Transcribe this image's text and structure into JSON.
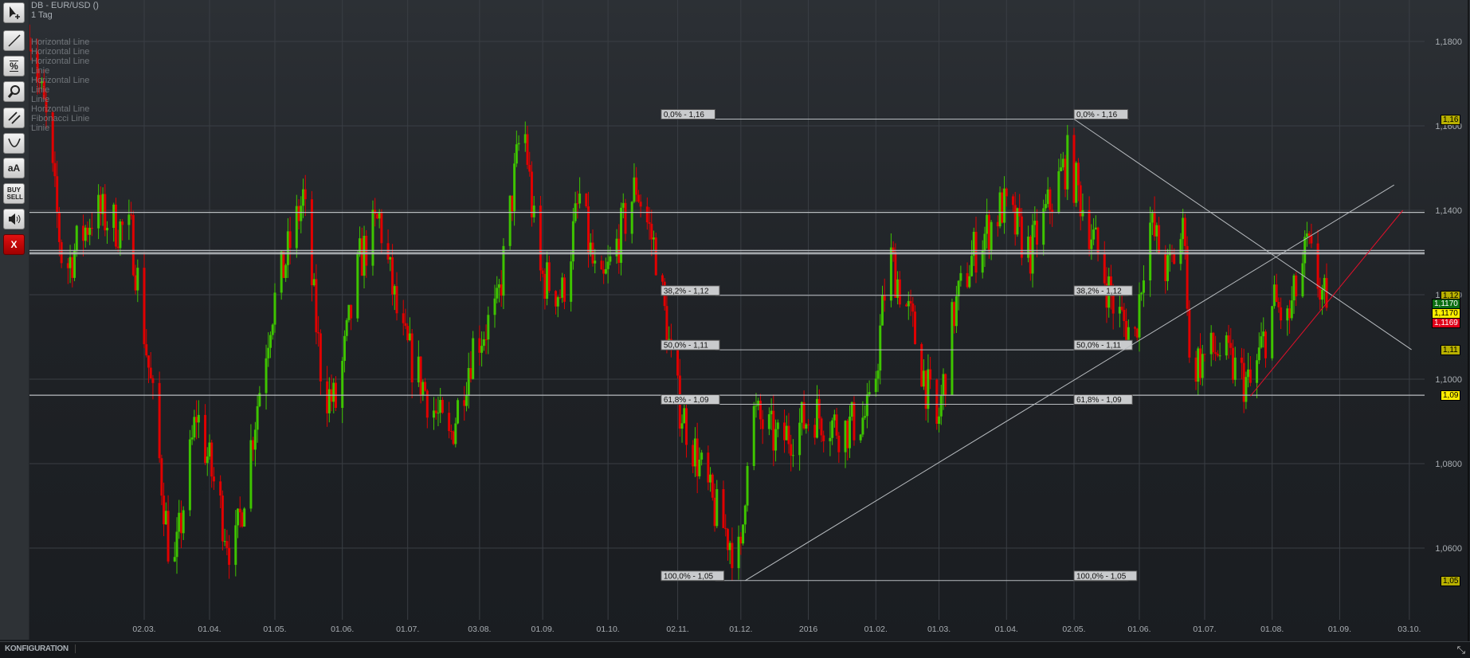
{
  "legend": {
    "title": "DB - EUR/USD ()",
    "interval": "1 Tag",
    "drawings": [
      "Horizontal Line",
      "Horizontal Line",
      "Horizontal Line",
      "Linie",
      "Horizontal Line",
      "Linie",
      "Linie",
      "Horizontal Line",
      "Fibonacci Linie",
      "Linie"
    ]
  },
  "toolbar": {
    "buttons": [
      {
        "name": "cursor-add-icon",
        "label": ""
      },
      {
        "name": "line-tool-icon",
        "label": ""
      },
      {
        "name": "percent-tool-icon",
        "label": "%"
      },
      {
        "name": "zoom-icon",
        "label": ""
      },
      {
        "name": "parallel-lines-icon",
        "label": ""
      },
      {
        "name": "curve-tool-icon",
        "label": ""
      },
      {
        "name": "text-tool-icon",
        "label": "aA"
      },
      {
        "name": "buy-sell-icon",
        "label": "BUY SELL"
      },
      {
        "name": "speaker-icon",
        "label": ""
      },
      {
        "name": "delete-icon",
        "label": "X"
      }
    ]
  },
  "bottom": {
    "config_label": "KONFIGURATION"
  },
  "colors": {
    "up": "#3ec400",
    "down": "#e00000",
    "grid": "#3a3e44",
    "drawing": "#b8bcc0",
    "trend_red": "#e0102a"
  },
  "chart_data": {
    "type": "candlestick",
    "title": "DB - EUR/USD ()",
    "interval": "1 Tag",
    "ylim": [
      1.04,
      1.19
    ],
    "y_ticks": [
      {
        "v": 1.18,
        "label": "1,1800"
      },
      {
        "v": 1.16,
        "label": "1,1600"
      },
      {
        "v": 1.14,
        "label": "1,1400"
      },
      {
        "v": 1.12,
        "label": "1,1200"
      },
      {
        "v": 1.1,
        "label": "1,1000"
      },
      {
        "v": 1.08,
        "label": "1,0800"
      },
      {
        "v": 1.06,
        "label": "1,0600"
      }
    ],
    "x_ticks": [
      {
        "date": "2015-03-02",
        "label": "02.03."
      },
      {
        "date": "2015-04-01",
        "label": "01.04."
      },
      {
        "date": "2015-05-01",
        "label": "01.05."
      },
      {
        "date": "2015-06-01",
        "label": "01.06."
      },
      {
        "date": "2015-07-01",
        "label": "01.07."
      },
      {
        "date": "2015-08-03",
        "label": "03.08."
      },
      {
        "date": "2015-09-01",
        "label": "01.09."
      },
      {
        "date": "2015-10-01",
        "label": "01.10."
      },
      {
        "date": "2015-11-02",
        "label": "02.11."
      },
      {
        "date": "2015-12-01",
        "label": "01.12."
      },
      {
        "date": "2016-01-01",
        "label": "2016"
      },
      {
        "date": "2016-02-01",
        "label": "01.02."
      },
      {
        "date": "2016-03-01",
        "label": "01.03."
      },
      {
        "date": "2016-04-01",
        "label": "01.04."
      },
      {
        "date": "2016-05-02",
        "label": "02.05."
      },
      {
        "date": "2016-06-01",
        "label": "01.06."
      },
      {
        "date": "2016-07-01",
        "label": "01.07."
      },
      {
        "date": "2016-08-01",
        "label": "01.08."
      },
      {
        "date": "2016-09-01",
        "label": "01.09."
      },
      {
        "date": "2016-10-03",
        "label": "03.10."
      }
    ],
    "price_path": [
      [
        "2015-01-08",
        1.184
      ],
      [
        "2015-01-16",
        1.161
      ],
      [
        "2015-01-24",
        1.125
      ],
      [
        "2015-02-07",
        1.14
      ],
      [
        "2015-02-24",
        1.134
      ],
      [
        "2015-02-28",
        1.12
      ],
      [
        "2015-03-07",
        1.09
      ],
      [
        "2015-03-15",
        1.052
      ],
      [
        "2015-03-26",
        1.092
      ],
      [
        "2015-04-12",
        1.057
      ],
      [
        "2015-04-29",
        1.115
      ],
      [
        "2015-05-14",
        1.143
      ],
      [
        "2015-05-23",
        1.098
      ],
      [
        "2015-05-29",
        1.094
      ],
      [
        "2015-06-09",
        1.128
      ],
      [
        "2015-06-18",
        1.138
      ],
      [
        "2015-06-28",
        1.11
      ],
      [
        "2015-07-20",
        1.085
      ],
      [
        "2015-07-31",
        1.108
      ],
      [
        "2015-08-11",
        1.116
      ],
      [
        "2015-08-23",
        1.163
      ],
      [
        "2015-08-30",
        1.125
      ],
      [
        "2015-09-10",
        1.12
      ],
      [
        "2015-09-18",
        1.143
      ],
      [
        "2015-09-27",
        1.119
      ],
      [
        "2015-10-14",
        1.146
      ],
      [
        "2015-10-23",
        1.13
      ],
      [
        "2015-11-01",
        1.097
      ],
      [
        "2015-11-18",
        1.07
      ],
      [
        "2015-12-01",
        1.057
      ],
      [
        "2015-12-05",
        1.093
      ],
      [
        "2015-12-18",
        1.085
      ],
      [
        "2016-01-04",
        1.092
      ],
      [
        "2016-01-17",
        1.088
      ],
      [
        "2016-01-30",
        1.092
      ],
      [
        "2016-02-07",
        1.13
      ],
      [
        "2016-02-18",
        1.112
      ],
      [
        "2016-02-29",
        1.088
      ],
      [
        "2016-03-08",
        1.116
      ],
      [
        "2016-03-17",
        1.13
      ],
      [
        "2016-03-30",
        1.141
      ],
      [
        "2016-04-12",
        1.13
      ],
      [
        "2016-04-29",
        1.152
      ],
      [
        "2016-05-08",
        1.138
      ],
      [
        "2016-05-21",
        1.116
      ],
      [
        "2016-05-30",
        1.11
      ],
      [
        "2016-06-05",
        1.138
      ],
      [
        "2016-06-14",
        1.125
      ],
      [
        "2016-06-22",
        1.136
      ],
      [
        "2016-06-24",
        1.103
      ],
      [
        "2016-07-07",
        1.107
      ],
      [
        "2016-07-22",
        1.098
      ],
      [
        "2016-08-02",
        1.118
      ],
      [
        "2016-08-08",
        1.113
      ],
      [
        "2016-08-17",
        1.131
      ],
      [
        "2016-08-26",
        1.1169
      ]
    ],
    "horizontal_lines": [
      1.1395,
      1.1305,
      1.13,
      1.1297,
      1.0962
    ],
    "fibonacci": {
      "from": [
        "2015-12-01",
        1.0523
      ],
      "to": [
        "2016-05-02",
        1.1616
      ],
      "end_date": "2016-05-27",
      "levels": [
        {
          "ratio": 0,
          "label": "0,0% - 1,16"
        },
        {
          "ratio": 0.382,
          "label": "38,2% - 1,12"
        },
        {
          "ratio": 0.5,
          "label": "50,0% - 1,11"
        },
        {
          "ratio": 0.618,
          "label": "61,8% - 1,09"
        },
        {
          "ratio": 1,
          "label": "100,0% - 1,05"
        }
      ]
    },
    "trend_lines": [
      {
        "from": [
          "2015-12-03",
          1.0523
        ],
        "to": [
          "2016-09-26",
          1.146
        ],
        "color": "drawing"
      },
      {
        "from": [
          "2016-05-02",
          1.1616
        ],
        "to": [
          "2016-10-04",
          1.107
        ],
        "color": "drawing"
      },
      {
        "from": [
          "2016-07-22",
          1.096
        ],
        "to": [
          "2016-09-30",
          1.14
        ],
        "color": "trend_red"
      }
    ],
    "price_tags": [
      {
        "v": 1.1616,
        "label": "1,16",
        "bg": "#b8b000",
        "fg": "#000"
      },
      {
        "v": 1.1199,
        "label": "1,12",
        "bg": "#b8b000",
        "fg": "#000"
      },
      {
        "v": 1.117,
        "label": "1,1170",
        "bg": "#0a6e12",
        "fg": "#fff",
        "offset": "low"
      },
      {
        "v": 1.117,
        "label": "1,1170",
        "bg": "#ffee00",
        "fg": "#000",
        "offset": "mid"
      },
      {
        "v": 1.1169,
        "label": "1,1169",
        "bg": "#e00018",
        "fg": "#fff",
        "offset": "high"
      },
      {
        "v": 1.107,
        "label": "1,11",
        "bg": "#b8b000",
        "fg": "#000"
      },
      {
        "v": 1.0962,
        "label": "1,09",
        "bg": "#ffee00",
        "fg": "#000"
      },
      {
        "v": 1.0523,
        "label": "1,05",
        "bg": "#b8b000",
        "fg": "#000"
      }
    ]
  }
}
